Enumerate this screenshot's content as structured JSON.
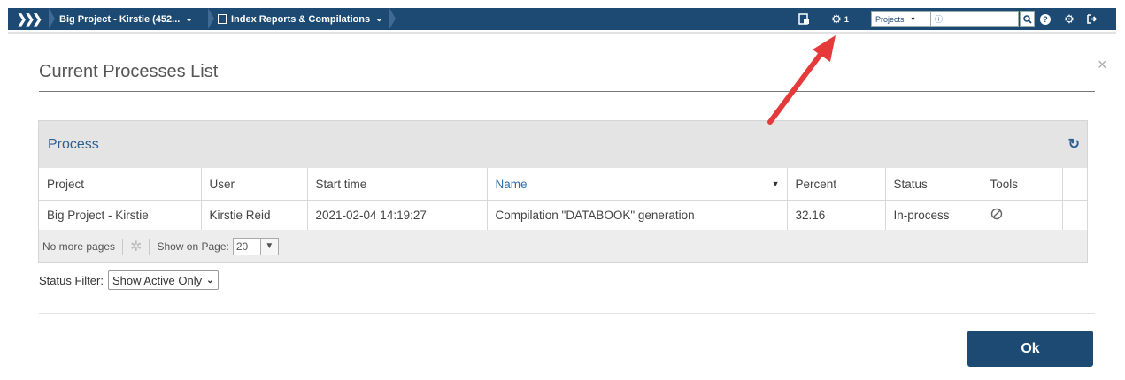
{
  "topbar": {
    "breadcrumbs": [
      {
        "label": "Big Project - Kirstie (452...",
        "icon": "project-icon"
      },
      {
        "label": "Index Reports & Compilations",
        "icon": "report-icon"
      }
    ],
    "process_count": "1",
    "search_scope": "Projects",
    "search_placeholder": "ⓘ",
    "colors": {
      "bar": "#1c4a73",
      "accent": "#2d6ea8"
    }
  },
  "modal": {
    "title": "Current Processes List",
    "close_label": "×",
    "panel_title": "Process",
    "columns": [
      "Project",
      "User",
      "Start time",
      "Name",
      "Percent",
      "Status",
      "Tools"
    ],
    "rows": [
      {
        "project": "Big Project - Kirstie",
        "user": "Kirstie Reid",
        "start_time": "2021-02-04 14:19:27",
        "name": "Compilation \"DATABOOK\" generation",
        "percent": "32.16",
        "status": "In-process",
        "tools_icon": "cancel-icon"
      }
    ],
    "pager": {
      "no_more_pages": "No more pages",
      "show_on_page_label": "Show on Page:",
      "page_size": "20"
    },
    "status_filter": {
      "label": "Status Filter:",
      "value": "Show Active Only"
    },
    "ok_label": "Ok"
  }
}
